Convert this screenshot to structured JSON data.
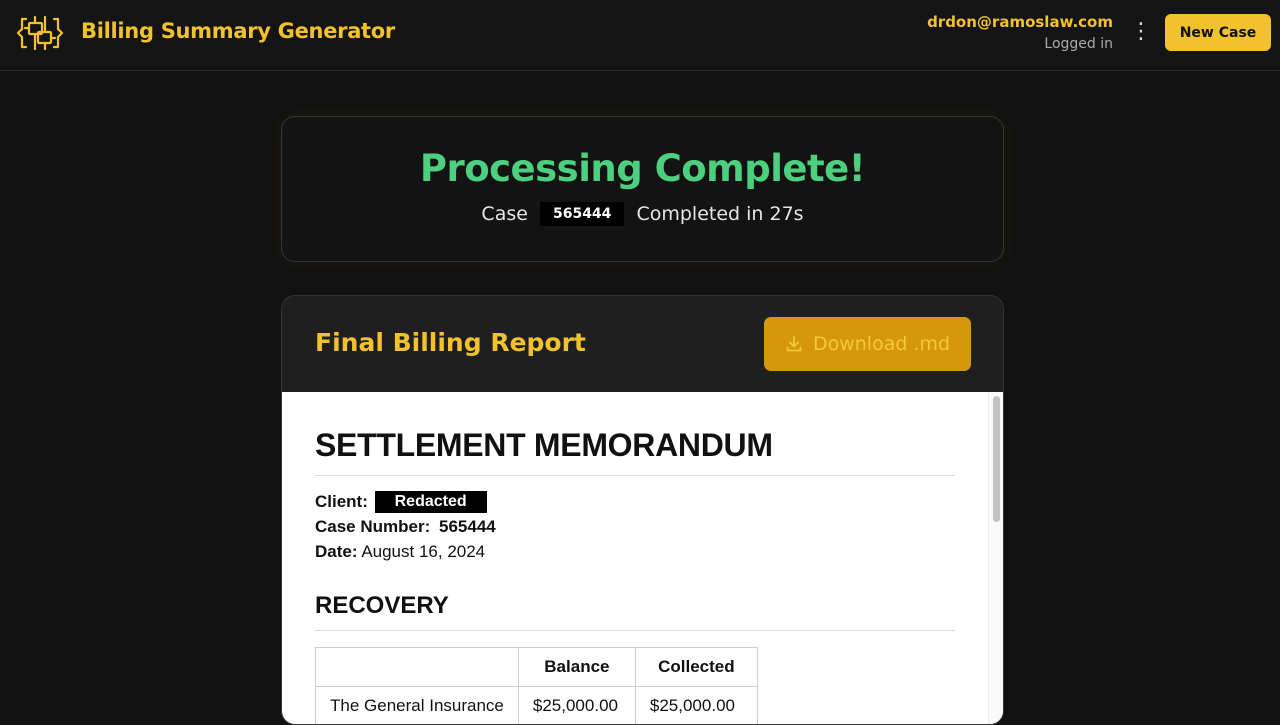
{
  "header": {
    "app_title": "Billing Summary Generator",
    "user_email": "drdon@ramoslaw.com",
    "user_status": "Logged in",
    "new_case_label": "New Case"
  },
  "status": {
    "title": "Processing Complete!",
    "case_prefix": "Case",
    "case_number": "565444",
    "completed_text": "Completed in 27s"
  },
  "report": {
    "title": "Final Billing Report",
    "download_label": "Download .md"
  },
  "document": {
    "heading": "SETTLEMENT MEMORANDUM",
    "client_label": "Client:",
    "client_value": "Redacted",
    "case_number_label": "Case Number:",
    "case_number_value": "565444",
    "date_label": "Date:",
    "date_value": "August 16, 2024",
    "section_heading": "RECOVERY",
    "table": {
      "headers": [
        "",
        "Balance",
        "Collected"
      ],
      "rows": [
        [
          "The General Insurance",
          "$25,000.00",
          "$25,000.00"
        ]
      ]
    }
  },
  "colors": {
    "accent": "#f2c12e",
    "success": "#4ccf7e",
    "background": "#111111",
    "download_button": "#d4980a"
  },
  "icons": {
    "logo": "circuit-logo-icon",
    "menu": "kebab-menu-icon",
    "download": "download-icon"
  }
}
